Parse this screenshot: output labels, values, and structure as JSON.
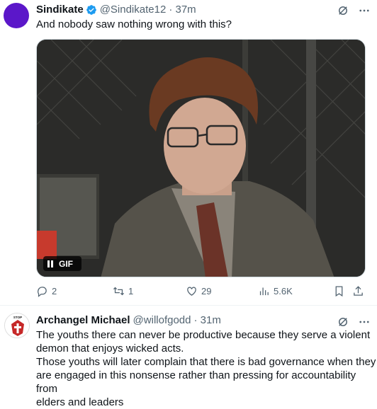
{
  "tweet1": {
    "name": "Sindikate",
    "handle": "@Sindikate12",
    "time": "· 37m",
    "text": "And nobody saw nothing wrong with this?",
    "media_badge": "GIF",
    "replies": "2",
    "reposts": "1",
    "likes": "29",
    "views": "5.6K"
  },
  "tweet2": {
    "name": "Archangel Michael",
    "handle": "@willofgodd",
    "time": "· 31m",
    "avatar_text": "STOP CHRISTIAN GENOCIDE NIGERIA",
    "text_lines": [
      "The youths there can never be productive because they serve a violent",
      "demon that enjoys wicked acts.",
      "Those youths will later complain that there is bad governance when they",
      "are engaged in this nonsense rather than pressing for accountability from",
      "elders and leaders"
    ]
  }
}
